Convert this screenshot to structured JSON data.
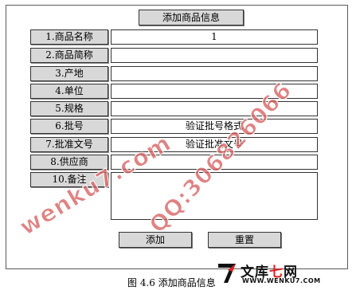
{
  "form": {
    "title": "添加商品信息",
    "rows": [
      {
        "label": "1.商品名称",
        "value": "1"
      },
      {
        "label": "2.商品简称",
        "value": ""
      },
      {
        "label": "3.产地",
        "value": ""
      },
      {
        "label": "4.单位",
        "value": ""
      },
      {
        "label": "5.规格",
        "value": ""
      },
      {
        "label": "6.批号",
        "value": "验证批号格式"
      },
      {
        "label": "7.批准文号",
        "value": "验证批准文号"
      },
      {
        "label": "8.供应商",
        "value": ""
      },
      {
        "label": "10.备注",
        "value": ""
      }
    ],
    "add_label": "添加",
    "reset_label": "重置"
  },
  "watermark": {
    "site": "wenku7.com",
    "qq": "QQ:306826066"
  },
  "logo": {
    "name_part1": "文库",
    "name_part2": "七",
    "name_part3": "网",
    "url": "WWW.WENKU7.COM"
  },
  "caption": "图 4.6 添加商品信息",
  "colors": {
    "label_bg": "#d8d8d8",
    "watermark": "#d66060",
    "logo_accent": "#dd2222"
  }
}
